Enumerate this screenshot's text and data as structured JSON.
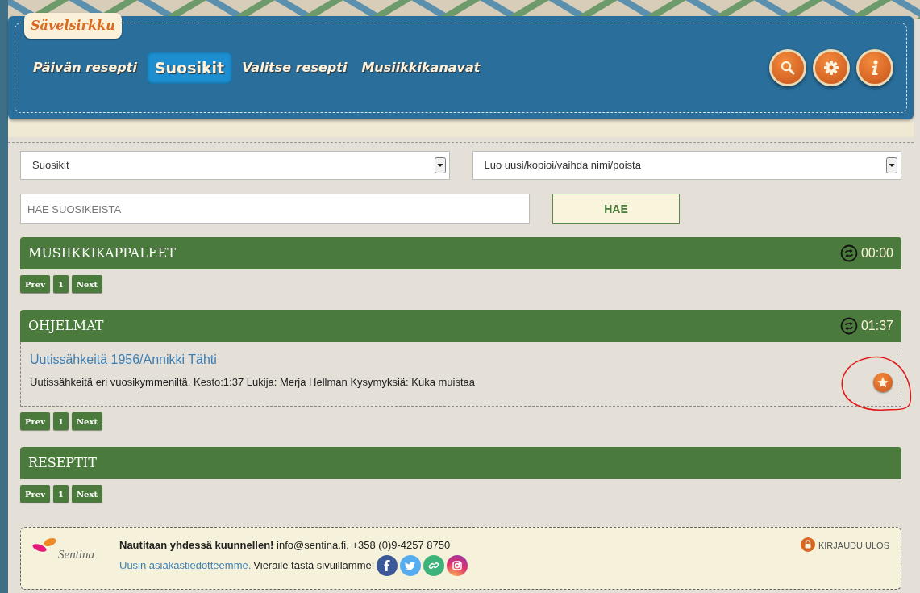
{
  "site": {
    "logo": "Sävelsirkku"
  },
  "nav": [
    {
      "label": "Päivän resepti",
      "selected": false
    },
    {
      "label": "Suosikit",
      "selected": true
    },
    {
      "label": "Valitse resepti",
      "selected": false
    },
    {
      "label": "Musiikkikanavat",
      "selected": false
    }
  ],
  "header_buttons": [
    {
      "kind": "search"
    },
    {
      "kind": "settings"
    },
    {
      "kind": "info"
    }
  ],
  "filters": {
    "list_select": "Suosikit",
    "action_select": "Luo uusi/kopioi/vaihda nimi/poista"
  },
  "search": {
    "placeholder": "HAE SUOSIKEISTA",
    "button": "HAE"
  },
  "sections": [
    {
      "title": "MUSIIKKIKAPPALEET",
      "duration": "00:00",
      "pager": {
        "prev": "Prev",
        "page": "1",
        "next": "Next"
      }
    },
    {
      "title": "OHJELMAT",
      "duration": "01:37",
      "items": [
        {
          "title": "Uutissähkeitä 1956/Annikki Tähti",
          "description": "Uutissähkeitä eri vuosikymmeniltä. Kesto:1:37 Lukija: Merja Hellman Kysymyksiä: Kuka muistaa",
          "favorite": true
        }
      ],
      "pager": {
        "prev": "Prev",
        "page": "1",
        "next": "Next"
      }
    },
    {
      "title": "RESEPTIT",
      "pager": {
        "prev": "Prev",
        "page": "1",
        "next": "Next"
      }
    }
  ],
  "footer": {
    "logo": "Sentina",
    "slogan": "Nautitaan yhdessä kuunnellen!",
    "contact": "info@sentina.fi, +358 (0)9-4257 8750",
    "link": "Uusin asiakastiedotteemme.",
    "visit": "Vieraile tästä sivuillamme:",
    "social": [
      {
        "kind": "facebook"
      },
      {
        "kind": "twitter"
      },
      {
        "kind": "link"
      },
      {
        "kind": "instagram"
      }
    ],
    "logout": "KIRJAUDU ULOS"
  }
}
